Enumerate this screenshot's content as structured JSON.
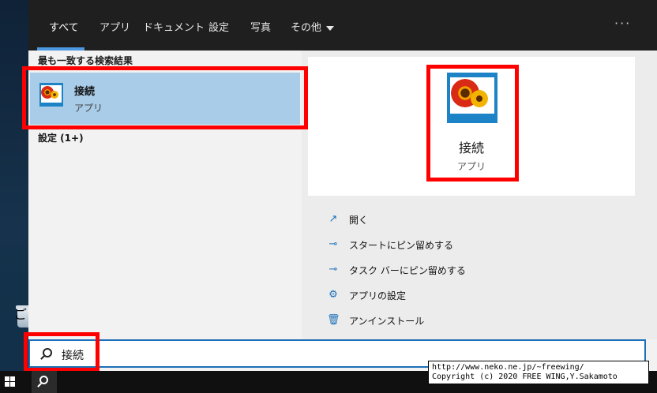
{
  "tabs": [
    {
      "label": "すべて",
      "active": true
    },
    {
      "label": "アプリ",
      "active": false
    },
    {
      "label": "ドキュメント",
      "active": false
    },
    {
      "label": "設定",
      "active": false
    },
    {
      "label": "写真",
      "active": false
    },
    {
      "label": "その他",
      "active": false
    }
  ],
  "more_label": "···",
  "left": {
    "section_title": "最も一致する検索結果",
    "best_match": {
      "name": "接続",
      "type": "アプリ",
      "icon": "connect-app-icon"
    },
    "settings_label": "設定 (1+)"
  },
  "detail": {
    "name": "接続",
    "type": "アプリ",
    "icon": "connect-app-icon",
    "actions": [
      {
        "icon": "open-icon",
        "label": "開く"
      },
      {
        "icon": "pin-icon",
        "label": "スタートにピン留めする"
      },
      {
        "icon": "pin-icon",
        "label": "タスク バーにピン留めする"
      },
      {
        "icon": "gear-icon",
        "label": "アプリの設定"
      },
      {
        "icon": "trash-icon",
        "label": "アンインストール"
      }
    ]
  },
  "search": {
    "value": "接続"
  },
  "desktop": {
    "recycle_label": "ご"
  },
  "watermark": {
    "line1": "http://www.neko.ne.jp/~freewing/",
    "line2": "Copyright (c) 2020 FREE WING,Y.Sakamoto"
  },
  "colors": {
    "accent": "#1c84c6",
    "highlight": "#a9cce8",
    "annotation": "#ff0000",
    "tab_underline": "#4c97e0"
  }
}
